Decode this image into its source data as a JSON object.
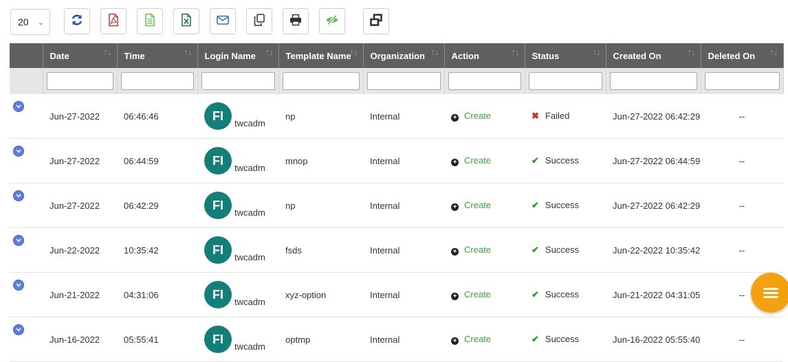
{
  "toolbar": {
    "page_size": "20",
    "buttons": [
      {
        "name": "refresh-button",
        "icon": "refresh-icon",
        "color": "#1f55c8"
      },
      {
        "name": "export-pdf-button",
        "icon": "pdf-icon",
        "color": "#d32f2f"
      },
      {
        "name": "export-text-button",
        "icon": "text-file-icon",
        "color": "#6abf4b"
      },
      {
        "name": "export-excel-button",
        "icon": "excel-icon",
        "color": "#1d6f42"
      },
      {
        "name": "email-button",
        "icon": "mail-icon",
        "color": "#2b6fd6"
      },
      {
        "name": "copy-button",
        "icon": "copy-icon",
        "color": "#333333"
      },
      {
        "name": "print-button",
        "icon": "printer-icon",
        "color": "#333333"
      },
      {
        "name": "visibility-button",
        "icon": "eye-slash-icon",
        "color": "#58c04a"
      },
      {
        "name": "window-restore-button",
        "icon": "window-restore-icon",
        "color": "#333333"
      }
    ]
  },
  "columns": [
    "Date",
    "Time",
    "Login Name",
    "Template Name",
    "Organization",
    "Action",
    "Status",
    "Created On",
    "Deleted On"
  ],
  "rows": [
    {
      "date": "Jun-27-2022",
      "time": "06:46:46",
      "initials": "FI",
      "login": "twcadm",
      "template": "np",
      "org": "Internal",
      "action": "Create",
      "status": "Failed",
      "created": "Jun-27-2022 06:42:29",
      "deleted": "--"
    },
    {
      "date": "Jun-27-2022",
      "time": "06:44:59",
      "initials": "FI",
      "login": "twcadm",
      "template": "mnop",
      "org": "Internal",
      "action": "Create",
      "status": "Success",
      "created": "Jun-27-2022 06:44:59",
      "deleted": "--"
    },
    {
      "date": "Jun-27-2022",
      "time": "06:42:29",
      "initials": "FI",
      "login": "twcadm",
      "template": "np",
      "org": "Internal",
      "action": "Create",
      "status": "Success",
      "created": "Jun-27-2022 06:42:29",
      "deleted": "--"
    },
    {
      "date": "Jun-22-2022",
      "time": "10:35:42",
      "initials": "FI",
      "login": "twcadm",
      "template": "fsds",
      "org": "Internal",
      "action": "Create",
      "status": "Success",
      "created": "Jun-22-2022 10:35:42",
      "deleted": "--"
    },
    {
      "date": "Jun-21-2022",
      "time": "04:31:06",
      "initials": "FI",
      "login": "twcadm",
      "template": "xyz-option",
      "org": "Internal",
      "action": "Create",
      "status": "Success",
      "created": "Jun-21-2022 04:31:05",
      "deleted": "--"
    },
    {
      "date": "Jun-16-2022",
      "time": "05:55:41",
      "initials": "FI",
      "login": "twcadm",
      "template": "optmp",
      "org": "Internal",
      "action": "Create",
      "status": "Success",
      "created": "Jun-16-2022 05:55:40",
      "deleted": "--"
    }
  ],
  "colors": {
    "header_bg": "#5f5f5f",
    "filter_bg": "#e6e6e6",
    "avatar": "#127f78",
    "action_link": "#3aa33f",
    "success": "#2a9a2a",
    "failed": "#d9231f",
    "fab": "#f5a10f",
    "expand": "#5b7de6"
  },
  "fab": {
    "icon": "menu-icon"
  }
}
